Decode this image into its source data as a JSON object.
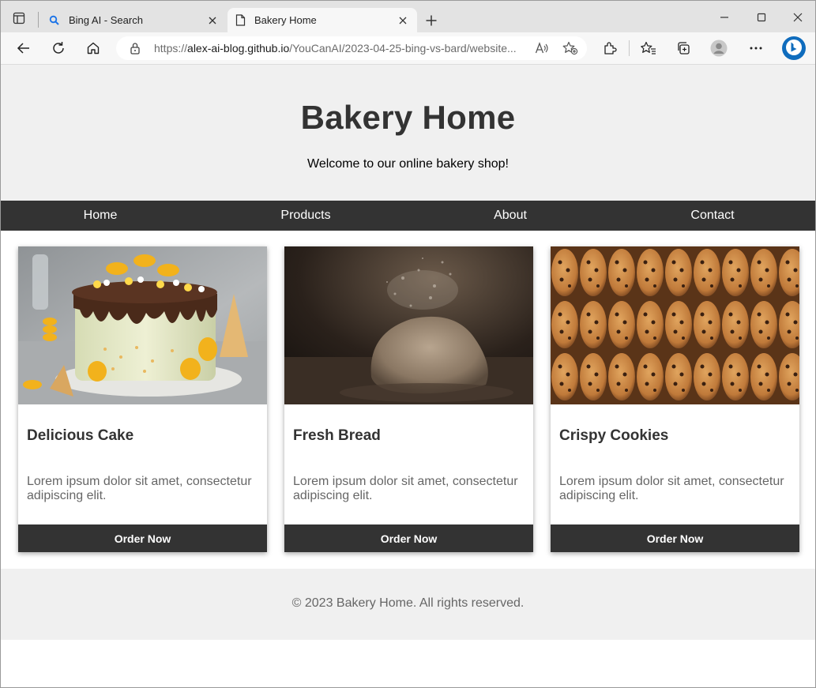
{
  "browser": {
    "tabs": [
      {
        "label": "Bing AI - Search",
        "icon": "search-icon"
      },
      {
        "label": "Bakery Home",
        "icon": "document-icon"
      }
    ],
    "address": {
      "prefix": "https://",
      "host": "alex-ai-blog.github.io",
      "path": "/YouCanAI/2023-04-25-bing-vs-bard/website..."
    },
    "colors": {
      "bing_blue": "#0f6cbd",
      "search_blue": "#1a73e8"
    }
  },
  "site": {
    "title": "Bakery Home",
    "tagline": "Welcome to our online bakery shop!",
    "nav": [
      "Home",
      "Products",
      "About",
      "Contact"
    ],
    "products": [
      {
        "name": "Delicious Cake",
        "description": "Lorem ipsum dolor sit amet, consectetur adipiscing elit.",
        "button": "Order Now",
        "image": "layered-cake-with-macarons-photo"
      },
      {
        "name": "Fresh Bread",
        "description": "Lorem ipsum dolor sit amet, consectetur adipiscing elit.",
        "button": "Order Now",
        "image": "bread-dough-with-flour-photo"
      },
      {
        "name": "Crispy Cookies",
        "description": "Lorem ipsum dolor sit amet, consectetur adipiscing elit.",
        "button": "Order Now",
        "image": "chocolate-chip-cookies-photo"
      }
    ],
    "footer": "© 2023 Bakery Home. All rights reserved.",
    "colors": {
      "header_bg": "#f0f0f0",
      "nav_bg": "#333333",
      "text": "#333333",
      "muted": "#666666"
    }
  }
}
